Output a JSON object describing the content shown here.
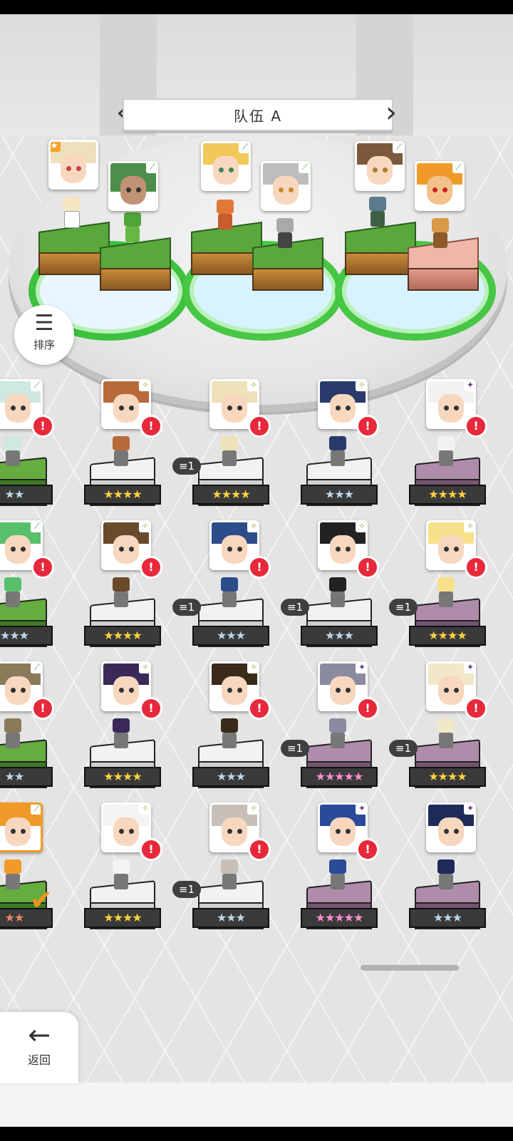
{
  "team": {
    "title": "队伍 A",
    "prev_icon": "chevron-left-icon",
    "next_icon": "chevron-right-icon"
  },
  "sort": {
    "label": "排序",
    "icon": "sort-icon"
  },
  "back": {
    "label": "返回",
    "icon": "arrow-left-icon"
  },
  "roster": {
    "rows": [
      {
        "cells": [
          {
            "stars": "★★",
            "tier": "silver",
            "elem": "⟋",
            "count": "",
            "alert": true,
            "pedestal": "green"
          },
          {
            "stars": "★★★★",
            "tier": "gold",
            "elem": "✧",
            "count": "",
            "alert": true,
            "pedestal": "white"
          },
          {
            "stars": "★★★★",
            "tier": "gold",
            "elem": "✧",
            "count": "1",
            "alert": true,
            "pedestal": "white"
          },
          {
            "stars": "★★★",
            "tier": "silver",
            "elem": "✧",
            "count": "",
            "alert": true,
            "pedestal": "white"
          },
          {
            "stars": "★★★★",
            "tier": "gold",
            "elem": "✦",
            "count": "",
            "alert": true,
            "pedestal": "purple"
          }
        ]
      },
      {
        "cells": [
          {
            "stars": "★★★",
            "tier": "silver",
            "elem": "⟋",
            "count": "",
            "alert": true,
            "pedestal": "green"
          },
          {
            "stars": "★★★★",
            "tier": "gold",
            "elem": "✧",
            "count": "",
            "alert": true,
            "pedestal": "white"
          },
          {
            "stars": "★★★",
            "tier": "silver",
            "elem": "✧",
            "count": "1",
            "alert": true,
            "pedestal": "white"
          },
          {
            "stars": "★★★",
            "tier": "silver",
            "elem": "✧",
            "count": "1",
            "alert": true,
            "pedestal": "white"
          },
          {
            "stars": "★★★★",
            "tier": "gold",
            "elem": "✧",
            "count": "1",
            "alert": true,
            "pedestal": "purple"
          }
        ]
      },
      {
        "cells": [
          {
            "stars": "★★",
            "tier": "silver",
            "elem": "⟋",
            "count": "",
            "alert": true,
            "pedestal": "green"
          },
          {
            "stars": "★★★★",
            "tier": "gold",
            "elem": "✧",
            "count": "",
            "alert": true,
            "pedestal": "white"
          },
          {
            "stars": "★★★",
            "tier": "silver",
            "elem": "✧",
            "count": "",
            "alert": true,
            "pedestal": "white"
          },
          {
            "stars": "★★★★★",
            "tier": "rainbow",
            "elem": "✦",
            "count": "1",
            "alert": true,
            "pedestal": "purple"
          },
          {
            "stars": "★★★★",
            "tier": "gold",
            "elem": "✦",
            "count": "1",
            "alert": true,
            "pedestal": "purple"
          }
        ]
      },
      {
        "cells": [
          {
            "stars": "★★",
            "tier": "bronze",
            "elem": "⟋",
            "count": "",
            "alert": false,
            "pedestal": "green",
            "selected": true
          },
          {
            "stars": "★★★★",
            "tier": "gold",
            "elem": "✧",
            "count": "",
            "alert": true,
            "pedestal": "white"
          },
          {
            "stars": "★★★",
            "tier": "silver",
            "elem": "✧",
            "count": "1",
            "alert": true,
            "pedestal": "white"
          },
          {
            "stars": "★★★★★",
            "tier": "rainbow",
            "elem": "✦",
            "count": "",
            "alert": true,
            "pedestal": "purple"
          },
          {
            "stars": "★★★",
            "tier": "silver",
            "elem": "✦",
            "count": "",
            "alert": false,
            "pedestal": "purple"
          }
        ]
      }
    ]
  },
  "alert_glyph": "!",
  "check_glyph": "✔"
}
